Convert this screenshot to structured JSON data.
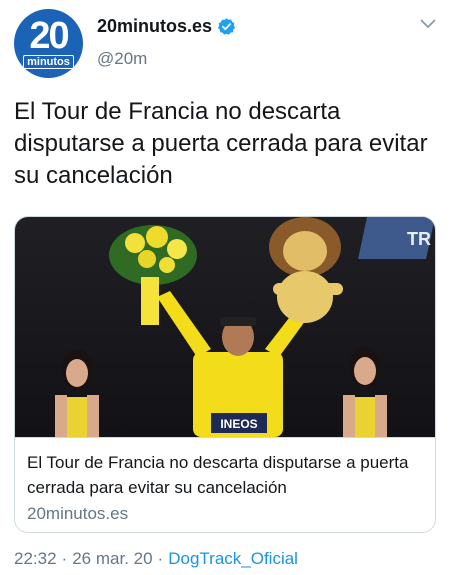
{
  "account": {
    "avatar_number": "20",
    "avatar_word": "minutos",
    "display_name": "20minutos.es",
    "handle": "@20m",
    "verified": true
  },
  "tweet": {
    "text": "El Tour de Francia no descarta disputarse a puerta cerrada para evitar su cancelación"
  },
  "card": {
    "title": "El Tour de Francia no descarta disputarse a puerta cerrada para evitar su cancelación",
    "domain": "20minutos.es",
    "image_banner_text": "TR",
    "jersey_text": "INEOS"
  },
  "meta": {
    "time": "22:32",
    "separator": "·",
    "date": "26 mar. 20",
    "source": "DogTrack_Oficial"
  },
  "colors": {
    "brand_blue": "#1b63b6",
    "link_blue": "#1b95e0",
    "secondary_text": "#657786",
    "jersey_yellow": "#f3dc1a"
  },
  "icons": {
    "verified": "verified-badge-icon",
    "menu": "chevron-down-icon"
  }
}
